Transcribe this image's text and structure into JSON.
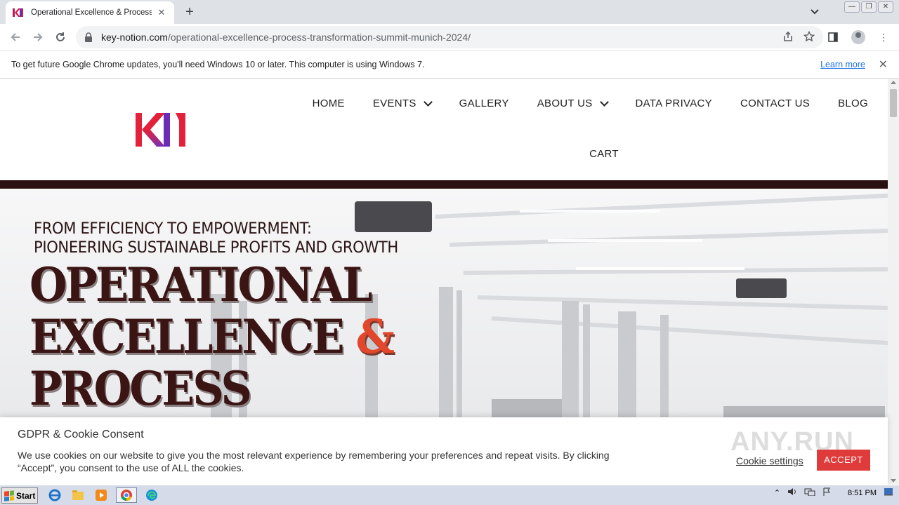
{
  "browser": {
    "tab_title": "Operational Excellence & Process Tra",
    "new_tab": "+",
    "url_domain": "key-notion.com",
    "url_path": "/operational-excellence-process-transformation-summit-munich-2024/"
  },
  "infobar": {
    "message": "To get future Google Chrome updates, you'll need Windows 10 or later. This computer is using Windows 7.",
    "learn_more": "Learn more"
  },
  "nav": {
    "items": [
      "HOME",
      "EVENTS",
      "GALLERY",
      "ABOUT US",
      "DATA PRIVACY",
      "CONTACT US",
      "BLOG",
      "CART"
    ]
  },
  "hero": {
    "subtitle_line1": "FROM EFFICIENCY TO EMPOWERMENT:",
    "subtitle_line2": "PIONEERING SUSTAINABLE PROFITS AND GROWTH",
    "title_line1": "OPERATIONAL",
    "title_line2": "EXCELLENCE",
    "title_amp": "&",
    "title_line3": "PROCESS"
  },
  "cookie": {
    "title": "GDPR & Cookie Consent",
    "body": "We use cookies on our website to give you the most relevant experience by remembering your preferences and repeat visits. By clicking “Accept”, you consent to the use of ALL the cookies.",
    "settings": "Cookie settings",
    "accept": "ACCEPT"
  },
  "watermark": "ANY.RUN",
  "taskbar": {
    "start": "Start",
    "clock": "8:51 PM"
  },
  "colors": {
    "brand_dark": "#3b1414",
    "accent_red": "#e2462b",
    "accept_red": "#e03b3b",
    "link_blue": "#1a73e8"
  }
}
